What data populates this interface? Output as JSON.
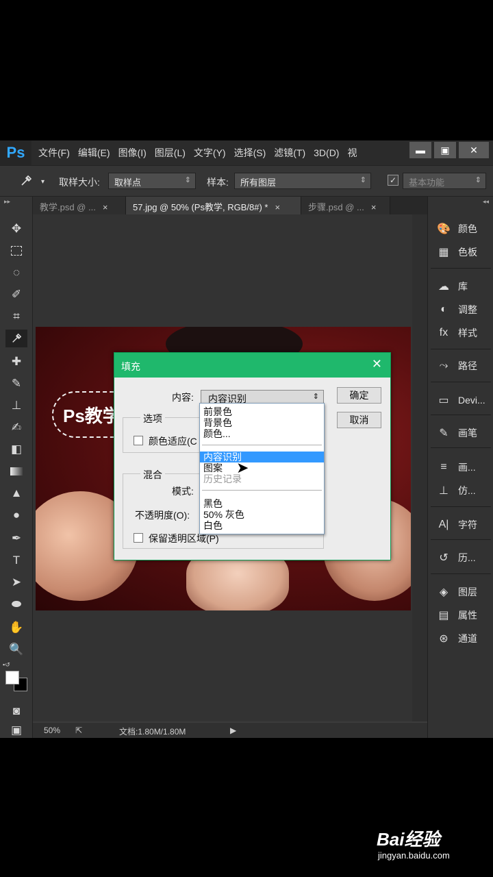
{
  "menubar": {
    "logo": "Ps",
    "items": [
      "文件(F)",
      "编辑(E)",
      "图像(I)",
      "图层(L)",
      "文字(Y)",
      "选择(S)",
      "滤镜(T)",
      "3D(D)",
      "视"
    ],
    "minimize": "▬",
    "restore": "▣",
    "close": "✕"
  },
  "options": {
    "tool_icon": "eyedropper-icon",
    "sample_size_label": "取样大小:",
    "sample_size_value": "取样点",
    "sample_label": "样本:",
    "sample_value": "所有图层",
    "workspace_value": "基本功能"
  },
  "tabs": [
    {
      "label": "教学.psd @ ...",
      "close": "×"
    },
    {
      "label": "57.jpg @ 50% (Ps教学, RGB/8#) *",
      "close": "×"
    },
    {
      "label": "步骤.psd @ ...",
      "close": "×"
    }
  ],
  "document": {
    "badge_text": "Ps教学"
  },
  "statusbar": {
    "zoom": "50%",
    "doc_info": "文档:1.80M/1.80M",
    "arrow": "▶"
  },
  "right_panel": [
    {
      "icon": "color-icon",
      "glyph": "🎨",
      "label": "颜色"
    },
    {
      "icon": "swatches-icon",
      "glyph": "▦",
      "label": "色板"
    },
    {
      "icon": "library-icon",
      "glyph": "☁",
      "label": "库"
    },
    {
      "icon": "adjustments-icon",
      "glyph": "◐",
      "label": "调整"
    },
    {
      "icon": "styles-icon",
      "glyph": "fx",
      "label": "样式"
    },
    {
      "icon": "paths-icon",
      "glyph": "⤳",
      "label": "路径"
    },
    {
      "icon": "device-icon",
      "glyph": "▭",
      "label": "Devi..."
    },
    {
      "icon": "brush-icon",
      "glyph": "✎",
      "label": "画笔"
    },
    {
      "icon": "brush-presets-icon",
      "glyph": "≡",
      "label": "画..."
    },
    {
      "icon": "clone-source-icon",
      "glyph": "⊥",
      "label": "仿..."
    },
    {
      "icon": "character-icon",
      "glyph": "A|",
      "label": "字符"
    },
    {
      "icon": "history-icon",
      "glyph": "↺",
      "label": "历..."
    },
    {
      "icon": "layers-icon",
      "glyph": "◈",
      "label": "图层"
    },
    {
      "icon": "properties-icon",
      "glyph": "▤",
      "label": "属性"
    },
    {
      "icon": "channels-icon",
      "glyph": "⊛",
      "label": "通道"
    }
  ],
  "dialog": {
    "title": "填充",
    "close": "✕",
    "content_label": "内容:",
    "content_value": "内容识别",
    "ok_label": "确定",
    "cancel_label": "取消",
    "options_group": "选项",
    "color_adapt_label": "颜色适应(C",
    "blend_group": "混合",
    "mode_label": "模式:",
    "opacity_label": "不透明度(O):",
    "preserve_label": "保留透明区域(P)"
  },
  "dropdown": {
    "items": [
      "前景色",
      "背景色",
      "颜色...",
      "内容识别",
      "图案",
      "历史记录",
      "黑色",
      "50% 灰色",
      "白色"
    ],
    "selected": "内容识别"
  },
  "watermark": {
    "brand": "Bai经验",
    "url": "jingyan.baidu.com"
  }
}
